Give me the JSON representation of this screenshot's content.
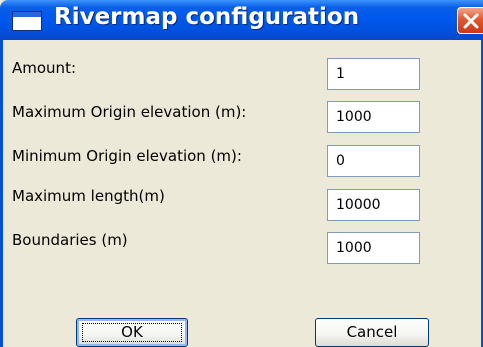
{
  "window": {
    "title": "Rivermap configuration",
    "icon": "window-icon",
    "close_icon": "close-icon"
  },
  "form": {
    "fields": [
      {
        "label": "Amount:",
        "value": "1"
      },
      {
        "label": "Maximum Origin elevation (m):",
        "value": "1000"
      },
      {
        "label": "Minimum Origin elevation (m):",
        "value": "0"
      },
      {
        "label": "Maximum length(m)",
        "value": "10000"
      },
      {
        "label": "Boundaries (m)",
        "value": "1000"
      }
    ]
  },
  "buttons": {
    "ok_label": "OK",
    "cancel_label": "Cancel"
  },
  "colors": {
    "titlebar": "#0058ee",
    "close_button": "#e0582f",
    "dialog_background": "#ece9d8",
    "field_border": "#7f9db9"
  }
}
